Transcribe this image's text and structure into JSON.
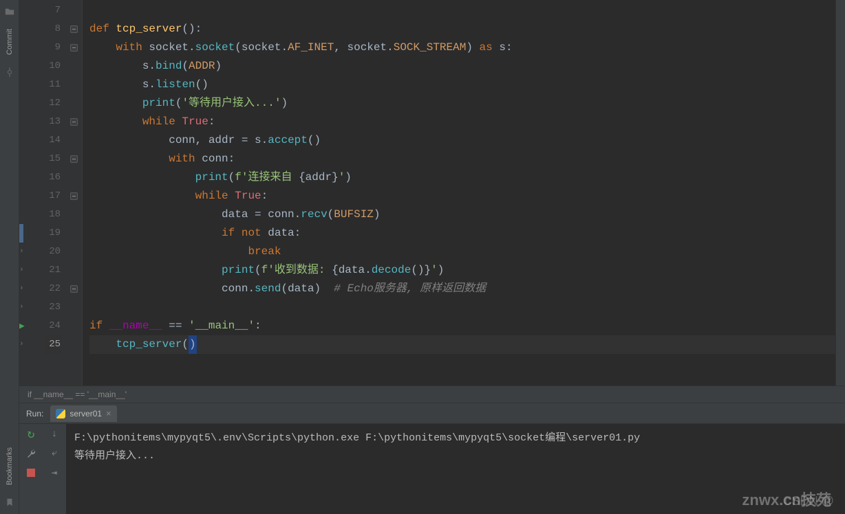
{
  "leftRail": {
    "top": "Commit",
    "bottom": "Bookmarks"
  },
  "gutter": {
    "start": 7,
    "end": 25,
    "selected": 25,
    "runLine": 24,
    "folds": [
      8,
      9,
      13,
      15,
      17,
      22
    ],
    "chevrons": [
      20,
      21,
      22,
      23,
      25
    ],
    "blueStart": 19,
    "blueEnd": 19,
    "blueLightStart": 13
  },
  "code": {
    "7": [],
    "8": [
      {
        "t": "def ",
        "c": "kw"
      },
      {
        "t": "tcp_server",
        "c": "fn"
      },
      {
        "t": "():",
        "c": "paren"
      }
    ],
    "9": [
      {
        "t": "    ",
        "c": ""
      },
      {
        "t": "with ",
        "c": "kw"
      },
      {
        "t": "socket",
        "c": "var"
      },
      {
        "t": ".",
        "c": "op"
      },
      {
        "t": "socket",
        "c": "call"
      },
      {
        "t": "(",
        "c": "paren"
      },
      {
        "t": "socket",
        "c": "var"
      },
      {
        "t": ".",
        "c": "op"
      },
      {
        "t": "AF_INET",
        "c": "param"
      },
      {
        "t": ", ",
        "c": "op"
      },
      {
        "t": "socket",
        "c": "var"
      },
      {
        "t": ".",
        "c": "op"
      },
      {
        "t": "SOCK_STREAM",
        "c": "param"
      },
      {
        "t": ") ",
        "c": "paren"
      },
      {
        "t": "as ",
        "c": "kw"
      },
      {
        "t": "s",
        "c": "var"
      },
      {
        "t": ":",
        "c": "op"
      }
    ],
    "10": [
      {
        "t": "        ",
        "c": ""
      },
      {
        "t": "s",
        "c": "var"
      },
      {
        "t": ".",
        "c": "op"
      },
      {
        "t": "bind",
        "c": "call"
      },
      {
        "t": "(",
        "c": "paren"
      },
      {
        "t": "ADDR",
        "c": "param"
      },
      {
        "t": ")",
        "c": "paren"
      }
    ],
    "11": [
      {
        "t": "        ",
        "c": ""
      },
      {
        "t": "s",
        "c": "var"
      },
      {
        "t": ".",
        "c": "op"
      },
      {
        "t": "listen",
        "c": "call"
      },
      {
        "t": "()",
        "c": "paren"
      }
    ],
    "12": [
      {
        "t": "        ",
        "c": ""
      },
      {
        "t": "print",
        "c": "call"
      },
      {
        "t": "(",
        "c": "paren"
      },
      {
        "t": "'等待用户接入...'",
        "c": "str"
      },
      {
        "t": ")",
        "c": "paren"
      }
    ],
    "13": [
      {
        "t": "        ",
        "c": ""
      },
      {
        "t": "while ",
        "c": "kw"
      },
      {
        "t": "True",
        "c": "builtin"
      },
      {
        "t": ":",
        "c": "op"
      }
    ],
    "14": [
      {
        "t": "            ",
        "c": ""
      },
      {
        "t": "conn",
        "c": "var"
      },
      {
        "t": ", ",
        "c": "op"
      },
      {
        "t": "addr",
        "c": "var"
      },
      {
        "t": " = ",
        "c": "op"
      },
      {
        "t": "s",
        "c": "var"
      },
      {
        "t": ".",
        "c": "op"
      },
      {
        "t": "accept",
        "c": "call"
      },
      {
        "t": "()",
        "c": "paren"
      }
    ],
    "15": [
      {
        "t": "            ",
        "c": ""
      },
      {
        "t": "with ",
        "c": "kw"
      },
      {
        "t": "conn",
        "c": "var"
      },
      {
        "t": ":",
        "c": "op"
      }
    ],
    "16": [
      {
        "t": "                ",
        "c": ""
      },
      {
        "t": "print",
        "c": "call"
      },
      {
        "t": "(",
        "c": "paren"
      },
      {
        "t": "f'连接来自 ",
        "c": "str"
      },
      {
        "t": "{",
        "c": "paren"
      },
      {
        "t": "addr",
        "c": "var"
      },
      {
        "t": "}",
        "c": "paren"
      },
      {
        "t": "'",
        "c": "str"
      },
      {
        "t": ")",
        "c": "paren"
      }
    ],
    "17": [
      {
        "t": "                ",
        "c": ""
      },
      {
        "t": "while ",
        "c": "kw"
      },
      {
        "t": "True",
        "c": "builtin"
      },
      {
        "t": ":",
        "c": "op"
      }
    ],
    "18": [
      {
        "t": "                    ",
        "c": ""
      },
      {
        "t": "data",
        "c": "var"
      },
      {
        "t": " = ",
        "c": "op"
      },
      {
        "t": "conn",
        "c": "var"
      },
      {
        "t": ".",
        "c": "op"
      },
      {
        "t": "recv",
        "c": "call"
      },
      {
        "t": "(",
        "c": "paren"
      },
      {
        "t": "BUFSIZ",
        "c": "param"
      },
      {
        "t": ")",
        "c": "paren"
      }
    ],
    "19": [
      {
        "t": "                    ",
        "c": ""
      },
      {
        "t": "if not ",
        "c": "kw"
      },
      {
        "t": "data",
        "c": "var"
      },
      {
        "t": ":",
        "c": "op"
      }
    ],
    "20": [
      {
        "t": "                        ",
        "c": ""
      },
      {
        "t": "break",
        "c": "kw"
      }
    ],
    "21": [
      {
        "t": "                    ",
        "c": ""
      },
      {
        "t": "print",
        "c": "call"
      },
      {
        "t": "(",
        "c": "paren"
      },
      {
        "t": "f'收到数据: ",
        "c": "str"
      },
      {
        "t": "{",
        "c": "paren"
      },
      {
        "t": "data",
        "c": "var"
      },
      {
        "t": ".",
        "c": "op"
      },
      {
        "t": "decode",
        "c": "call"
      },
      {
        "t": "()",
        "c": "paren"
      },
      {
        "t": "}",
        "c": "paren"
      },
      {
        "t": "'",
        "c": "str"
      },
      {
        "t": ")",
        "c": "paren"
      }
    ],
    "22": [
      {
        "t": "                    ",
        "c": ""
      },
      {
        "t": "conn",
        "c": "var"
      },
      {
        "t": ".",
        "c": "op"
      },
      {
        "t": "send",
        "c": "call"
      },
      {
        "t": "(",
        "c": "paren"
      },
      {
        "t": "data",
        "c": "var"
      },
      {
        "t": ")",
        "c": "paren"
      },
      {
        "t": "  ",
        "c": ""
      },
      {
        "t": "# Echo服务器, 原样返回数据",
        "c": "comment"
      }
    ],
    "23": [],
    "24": [
      {
        "t": "if ",
        "c": "kw"
      },
      {
        "t": "__name__",
        "c": "dunder"
      },
      {
        "t": " == ",
        "c": "op"
      },
      {
        "t": "'__main__'",
        "c": "str"
      },
      {
        "t": ":",
        "c": "op"
      }
    ],
    "25": [
      {
        "t": "    ",
        "c": ""
      },
      {
        "t": "tcp_server",
        "c": "call"
      },
      {
        "t": "(",
        "c": "paren"
      },
      {
        "t": ")",
        "c": "paren cursor-box"
      }
    ]
  },
  "breadcrumb": "if __name__ == '__main__'",
  "runPanel": {
    "label": "Run:",
    "tab": "server01",
    "console": [
      "F:\\pythonitems\\mypyqt5\\.env\\Scripts\\python.exe F:\\pythonitems\\mypyqt5\\socket编程\\server01.py",
      "等待用户接入..."
    ]
  },
  "watermarks": {
    "a": "CSDN @",
    "b": "znwx.cn技苑"
  }
}
